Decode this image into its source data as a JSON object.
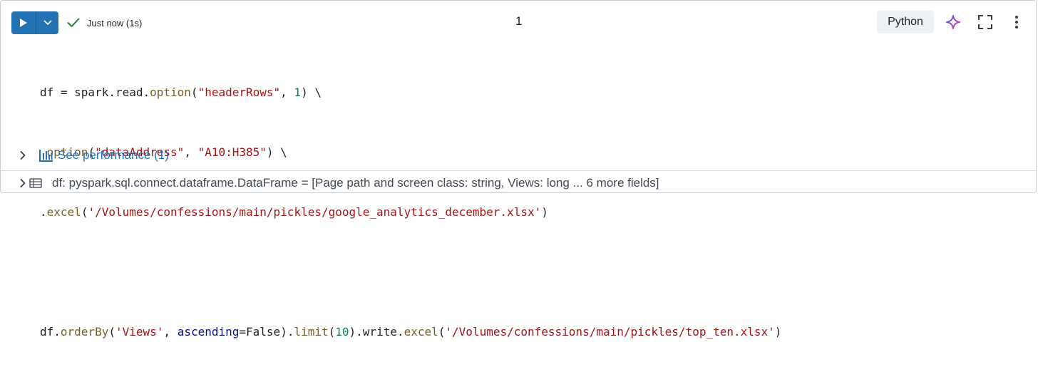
{
  "toolbar": {
    "run_icon": "play-icon",
    "run_menu_icon": "chevron-down-icon",
    "status_icon": "checkmark-icon",
    "status_text": "Just now (1s)",
    "cell_number": "1",
    "language": "Python",
    "assistant_icon": "sparkle-icon",
    "expand_icon": "fullscreen-icon",
    "menu_icon": "kebab-menu-icon"
  },
  "code": {
    "line1": {
      "a": "df = spark.read.",
      "fn": "option",
      "b": "(",
      "str": "\"headerRows\"",
      "c": ", ",
      "num": "1",
      "d": ") \\"
    },
    "line2": {
      "a": ".",
      "fn": "option",
      "b": "(",
      "str1": "\"dataAddress\"",
      "c": ", ",
      "str2": "\"A10:H385\"",
      "d": ") \\"
    },
    "line3": {
      "a": ".",
      "fn": "excel",
      "b": "(",
      "str": "'/Volumes/confessions/main/pickles/google_analytics_december.xlsx'",
      "c": ")"
    },
    "line5": {
      "a": "df.",
      "fn1": "orderBy",
      "b": "(",
      "str1": "'Views'",
      "c": ", ",
      "kw": "ascending",
      "d": "=False).",
      "fn2": "limit",
      "e": "(",
      "num": "10",
      "f": ").write.",
      "fn3": "excel",
      "g": "(",
      "str2": "'/Volumes/confessions/main/pickles/top_ten.xlsx'",
      "h": ")"
    }
  },
  "performance": {
    "chevron_icon": "chevron-right-icon",
    "chart_icon": "bar-chart-icon",
    "label": "See performance (1)"
  },
  "dataframe": {
    "chevron_icon": "chevron-right-icon",
    "table_icon": "table-icon",
    "text": "df:  pyspark.sql.connect.dataframe.DataFrame = [Page path and screen class: string, Views: long ... 6 more fields]"
  },
  "colors": {
    "accent": "#2272b4",
    "string": "#a31515",
    "number": "#098658",
    "function": "#795e26",
    "keyword": "#001080"
  }
}
